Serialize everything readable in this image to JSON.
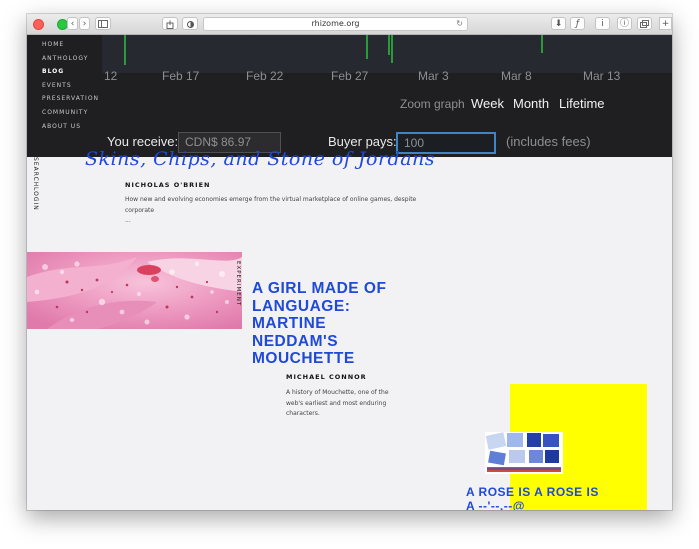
{
  "browser": {
    "url": "rhizome.org"
  },
  "chart": {
    "x_ticks": [
      "12",
      "Feb 17",
      "Feb 22",
      "Feb 27",
      "Mar 3",
      "Mar 8",
      "Mar 13"
    ],
    "zoom_label": "Zoom graph",
    "zoom_options": [
      "Week",
      "Month",
      "Lifetime"
    ],
    "receive_label": "You receive:",
    "receive_value": "CDN$ 86.97",
    "pays_label": "Buyer pays:",
    "pays_value": "100",
    "fees_note": "(includes fees)"
  },
  "nav": {
    "items": [
      "HOME",
      "ANTHOLOGY",
      "BLOG",
      "EVENTS",
      "PRESERVATION",
      "COMMUNITY",
      "ABOUT US"
    ],
    "active": "BLOG",
    "search": "SEARCH",
    "login": "LOGIN"
  },
  "articles": [
    {
      "title": "Skins, Chips, and Stone of Jordans",
      "author": "NICHOLAS O'BRIEN",
      "description": "How new and evolving economies emerge from the virtual marketplace of online games, despite corporate",
      "ellipsis": "..."
    },
    {
      "tag": "EXPERIMENT",
      "title_lines": [
        "A GIRL MADE OF",
        "LANGUAGE:",
        "MARTINE",
        "NEDDAM'S",
        "MOUCHETTE"
      ],
      "author": "MICHAEL CONNOR",
      "description_lines": [
        "A history of Mouchette, one of the",
        "web's earliest and most enduring",
        "characters."
      ]
    },
    {
      "title_lines": [
        "A ROSE IS A ROSE IS",
        "A --'--,--@"
      ],
      "accent": "#ffff00"
    }
  ],
  "colors": {
    "accent_blue": "#1f49d8",
    "dark_panel": "#1f1f21",
    "highlight_yellow": "#ffff00"
  }
}
